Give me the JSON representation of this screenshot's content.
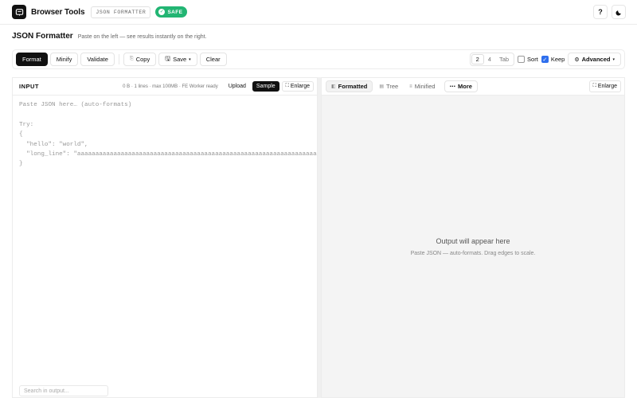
{
  "header": {
    "brand": "Browser Tools",
    "tag": "JSON FORMATTER",
    "safe_badge": "SAFE",
    "help_label": "?",
    "theme_icon": "moon-icon"
  },
  "page": {
    "title": "JSON Formatter",
    "subtitle": "Paste on the left — see results instantly on the right."
  },
  "toolbar": {
    "format_label": "Format",
    "minify_label": "Minify",
    "validate_label": "Validate",
    "copy_label": "Copy",
    "save_label": "Save",
    "clear_label": "Clear",
    "indent_options": [
      "2",
      "4",
      "Tab"
    ],
    "indent_selected": "2",
    "sort_label": "Sort",
    "sort_checked": false,
    "keep_label": "Keep",
    "keep_checked": true,
    "advanced_label": "Advanced"
  },
  "input_pane": {
    "label": "INPUT",
    "meta": "0 B · 1 lines · max 100MB · FE Worker ready",
    "upload_label": "Upload",
    "sample_label": "Sample",
    "enlarge_label": "Enlarge",
    "placeholder": "Paste JSON here… (auto-formats)\n\nTry:\n{\n  \"hello\": \"world\",\n  \"long_line\": \"aaaaaaaaaaaaaaaaaaaaaaaaaaaaaaaaaaaaaaaaaaaaaaaaaaaaaaaaaaaaaaaaaaaaaaaaaaaaaaaaaaaaaaaaaaaaaaaa\"\n}",
    "search_placeholder": "Search in output..."
  },
  "output_pane": {
    "tabs": [
      "Formatted",
      "Tree",
      "Minified"
    ],
    "active_tab": "Formatted",
    "more_label": "More",
    "enlarge_label": "Enlarge",
    "empty_title": "Output will appear here",
    "empty_subtitle": "Paste JSON — auto-formats. Drag edges to scale."
  },
  "colors": {
    "safe_green": "#22b573",
    "primary_dark": "#111111",
    "checkbox_blue": "#2f6fed"
  }
}
